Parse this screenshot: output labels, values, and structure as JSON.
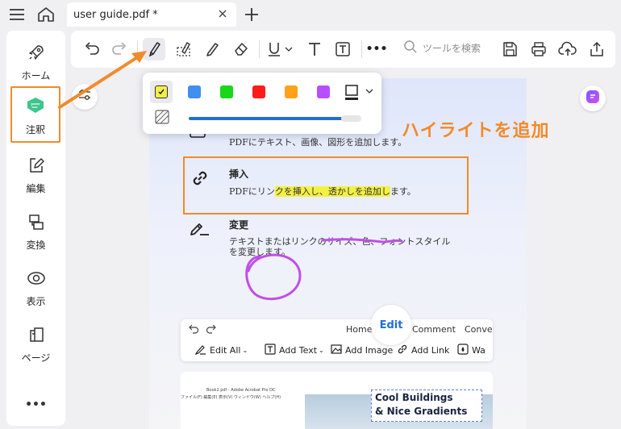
{
  "tab": {
    "title": "user guide.pdf *"
  },
  "sidebar": {
    "items": [
      {
        "label": "ホーム",
        "icon": "rocket-icon"
      },
      {
        "label": "注釈",
        "icon": "highlighter-icon",
        "active": true
      },
      {
        "label": "編集",
        "icon": "edit-icon"
      },
      {
        "label": "変換",
        "icon": "convert-icon"
      },
      {
        "label": "表示",
        "icon": "view-icon"
      },
      {
        "label": "ページ",
        "icon": "page-icon"
      }
    ],
    "more": "•••"
  },
  "toolbar": {
    "search_placeholder": "ツールを検索",
    "more": "•••"
  },
  "popup": {
    "colors": [
      "#f3f046",
      "#3f8ef0",
      "#19d819",
      "#ff1a1a",
      "#ffa21a",
      "#b84fff"
    ],
    "selected_color": "#f3f046",
    "thickness": 0.9
  },
  "callout": {
    "text": "ハイライトを追加"
  },
  "page": {
    "add_text": "PDFにテキスト、画像、図形を追加します。",
    "insert": {
      "heading": "挿入",
      "text_before": "PDFにリン",
      "text_highlight": "クを挿入し、透かしを追加し",
      "text_after": "ます。"
    },
    "change": {
      "heading": "変更",
      "line1_a": "テキストまたはリンクの",
      "line1_b": "サイズ、色、",
      "line1_c": "フォントスタイル",
      "line2": "を変更します。"
    }
  },
  "embed": {
    "edit_label": "Edit",
    "tabs": [
      "Home",
      "Comment",
      "Convert"
    ],
    "tools": [
      "Edit All",
      "Add Text",
      "Add Image",
      "Add Link",
      "Wa"
    ],
    "mini_title": "Book2.pdf - Adobe Acrobat Pro DC",
    "mini_menu": "ファイル(F)   編集(E)   表示(V)   ウィンドウ(W)   ヘルプ(H)",
    "card_line1": "Cool Buildings",
    "card_line2": "& Nice Gradients"
  }
}
